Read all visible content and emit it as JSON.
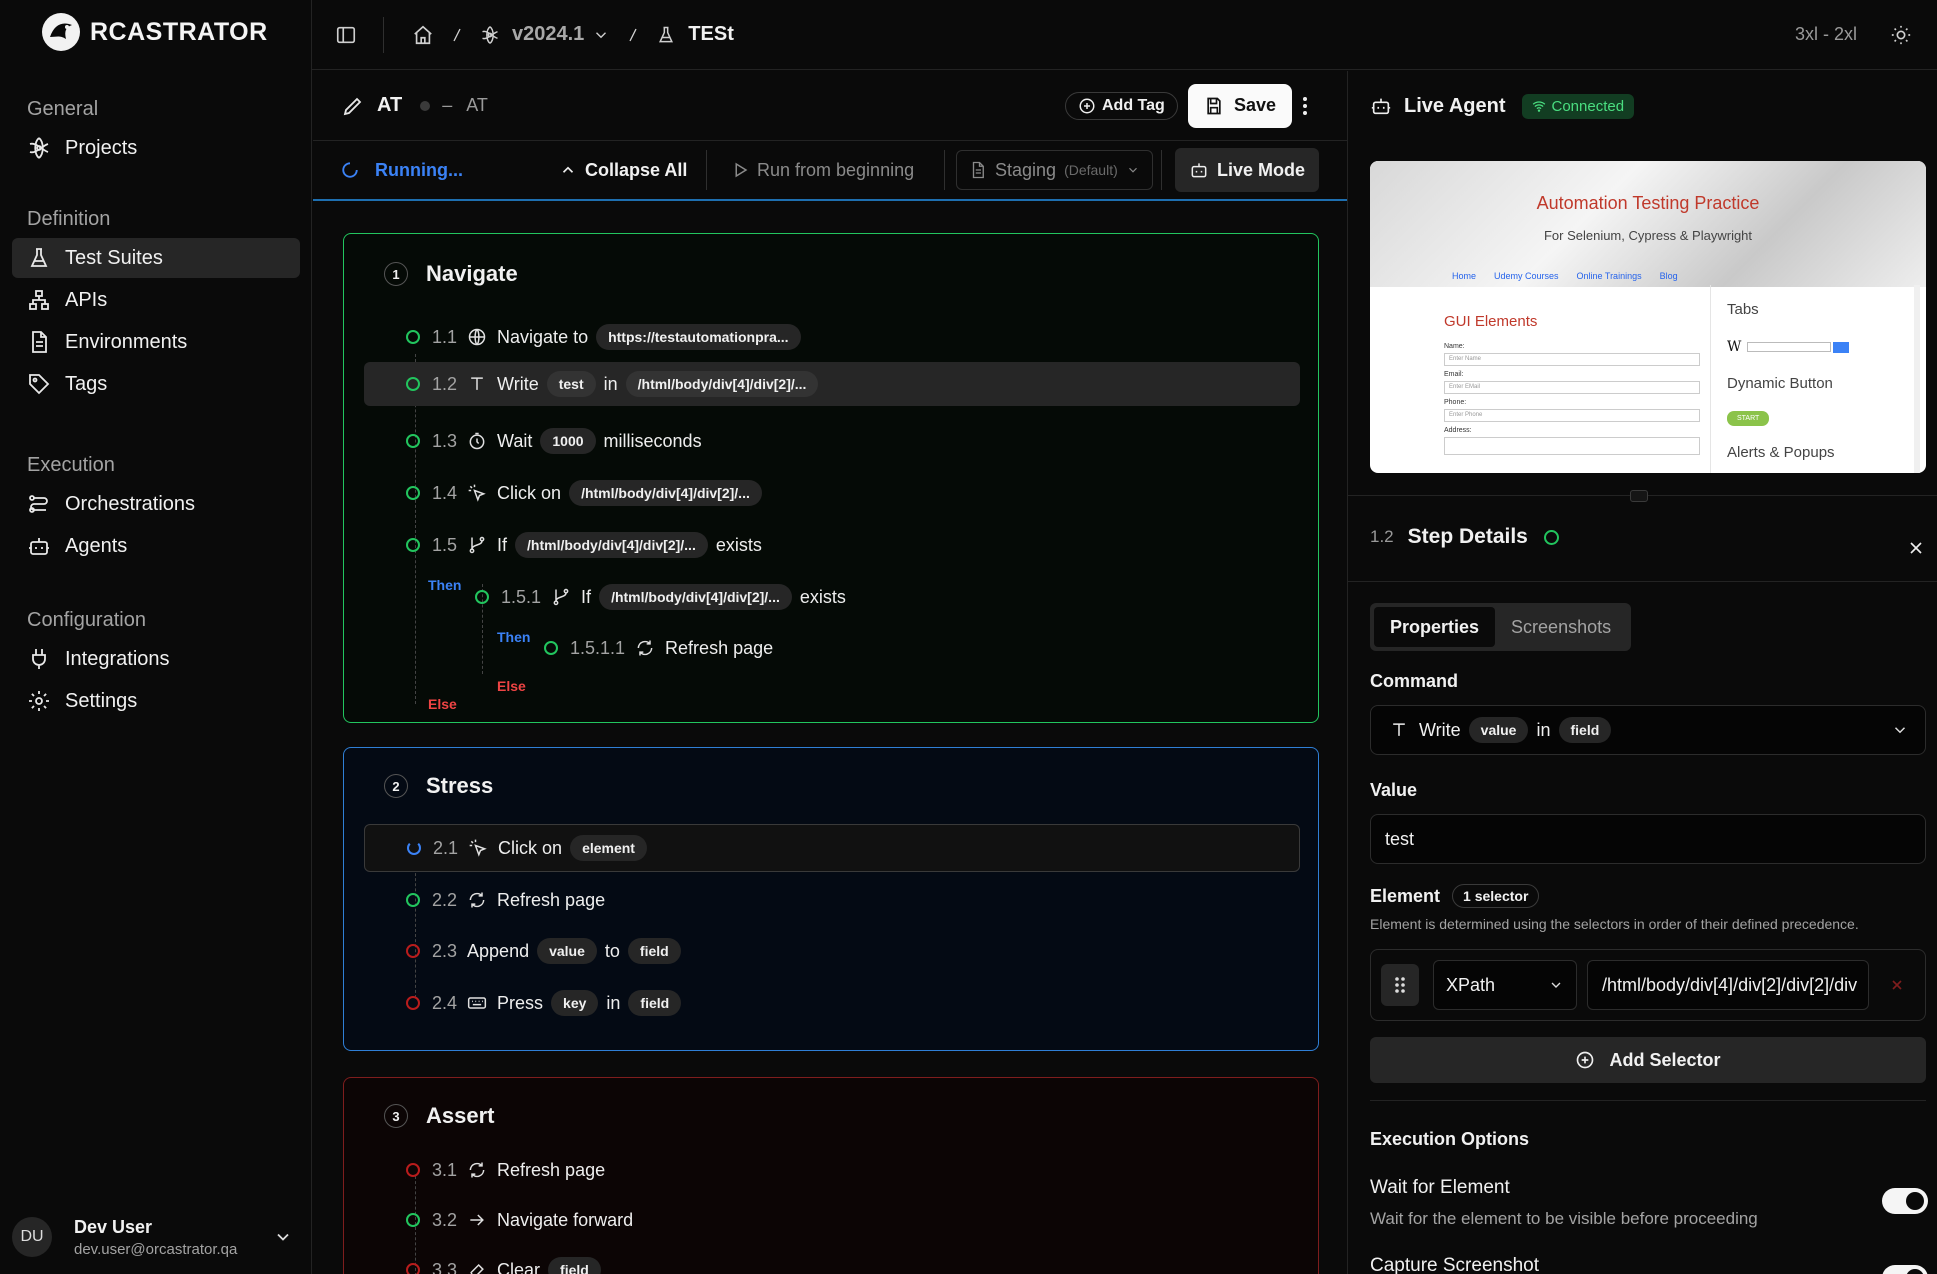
{
  "app": {
    "name": "RCASTRATOR"
  },
  "sidebar": {
    "sections": [
      {
        "title": "General",
        "items": [
          {
            "label": "Projects",
            "icon": "projects-icon"
          }
        ]
      },
      {
        "title": "Definition",
        "items": [
          {
            "label": "Test Suites",
            "icon": "flask-icon",
            "active": true
          },
          {
            "label": "APIs",
            "icon": "api-icon"
          },
          {
            "label": "Environments",
            "icon": "document-icon"
          },
          {
            "label": "Tags",
            "icon": "tag-icon"
          }
        ]
      },
      {
        "title": "Execution",
        "items": [
          {
            "label": "Orchestrations",
            "icon": "orchestration-icon"
          },
          {
            "label": "Agents",
            "icon": "bot-icon"
          }
        ]
      },
      {
        "title": "Configuration",
        "items": [
          {
            "label": "Integrations",
            "icon": "plug-icon"
          },
          {
            "label": "Settings",
            "icon": "gear-icon"
          }
        ]
      }
    ],
    "user": {
      "initials": "DU",
      "name": "Dev User",
      "email": "dev.user@orcastrator.qa"
    }
  },
  "topbar": {
    "version": "v2024.1",
    "suite": "TESt",
    "breakpoint": "3xl - 2xl"
  },
  "editor": {
    "title": "AT",
    "subtitle": "AT",
    "separator": "–",
    "add_tag": "Add Tag",
    "save": "Save",
    "status": "Running...",
    "collapse_all": "Collapse All",
    "run_from_beginning": "Run from beginning",
    "environment": "Staging",
    "environment_default": "(Default)",
    "live_mode": "Live Mode",
    "groups": [
      {
        "num": "1",
        "title": "Navigate",
        "color": "#22c55e"
      },
      {
        "num": "2",
        "title": "Stress",
        "color": "#3b82f6"
      },
      {
        "num": "3",
        "title": "Assert",
        "color": "#b91c1c"
      }
    ],
    "steps": {
      "s11": {
        "num": "1.1",
        "a": "Navigate to",
        "chip1": "https://testautomationpra..."
      },
      "s12": {
        "num": "1.2",
        "a": "Write",
        "chip1": "test",
        "b": "in",
        "chip2": "/html/body/div[4]/div[2]/..."
      },
      "s13": {
        "num": "1.3",
        "a": "Wait",
        "chip1": "1000",
        "b": "milliseconds"
      },
      "s14": {
        "num": "1.4",
        "a": "Click on",
        "chip1": "/html/body/div[4]/div[2]/..."
      },
      "s15": {
        "num": "1.5",
        "a": "If",
        "chip1": "/html/body/div[4]/div[2]/...",
        "b": "exists"
      },
      "s151": {
        "num": "1.5.1",
        "a": "If",
        "chip1": "/html/body/div[4]/div[2]/...",
        "b": "exists"
      },
      "s1511": {
        "num": "1.5.1.1",
        "a": "Refresh page"
      },
      "s21": {
        "num": "2.1",
        "a": "Click on",
        "chip1": "element"
      },
      "s22": {
        "num": "2.2",
        "a": "Refresh page"
      },
      "s23": {
        "num": "2.3",
        "a": "Append",
        "chip1": "value",
        "b": "to",
        "chip2": "field"
      },
      "s24": {
        "num": "2.4",
        "a": "Press",
        "chip1": "key",
        "b": "in",
        "chip2": "field"
      },
      "s31": {
        "num": "3.1",
        "a": "Refresh page"
      },
      "s32": {
        "num": "3.2",
        "a": "Navigate forward"
      },
      "s33": {
        "num": "3.3",
        "a": "Clear",
        "chip1": "field"
      }
    },
    "then": "Then",
    "else": "Else"
  },
  "panel": {
    "title": "Live Agent",
    "connected": "Connected",
    "preview": {
      "heading": "Automation Testing Practice",
      "sub": "For Selenium, Cypress & Playwright",
      "nav": [
        "Home",
        "Udemy Courses",
        "Online Trainings",
        "Blog"
      ],
      "gui": "GUI Elements",
      "tabs": "Tabs",
      "dynamic": "Dynamic Button",
      "alerts": "Alerts & Popups",
      "start": "START",
      "fields": [
        {
          "label": "Name:",
          "ph": "Enter Name"
        },
        {
          "label": "Email:",
          "ph": "Enter EMail"
        },
        {
          "label": "Phone:",
          "ph": "Enter Phone"
        },
        {
          "label": "Address:",
          "ph": ""
        }
      ]
    },
    "step_num": "1.2",
    "step_title": "Step Details",
    "tabs": [
      "Properties",
      "Screenshots"
    ],
    "command_label": "Command",
    "command": {
      "a": "Write",
      "chip1": "value",
      "b": "in",
      "chip2": "field"
    },
    "value_label": "Value",
    "value": "test",
    "element_label": "Element",
    "selector_count": "1 selector",
    "element_help": "Element is determined using the selectors in order of their defined precedence.",
    "selector_type": "XPath",
    "selector_value": "/html/body/div[4]/div[2]/div[2]/div",
    "add_selector": "Add Selector",
    "exec_title": "Execution Options",
    "wait_title": "Wait for Element",
    "wait_desc": "Wait for the element to be visible before proceeding",
    "capture_title": "Capture Screenshot"
  }
}
